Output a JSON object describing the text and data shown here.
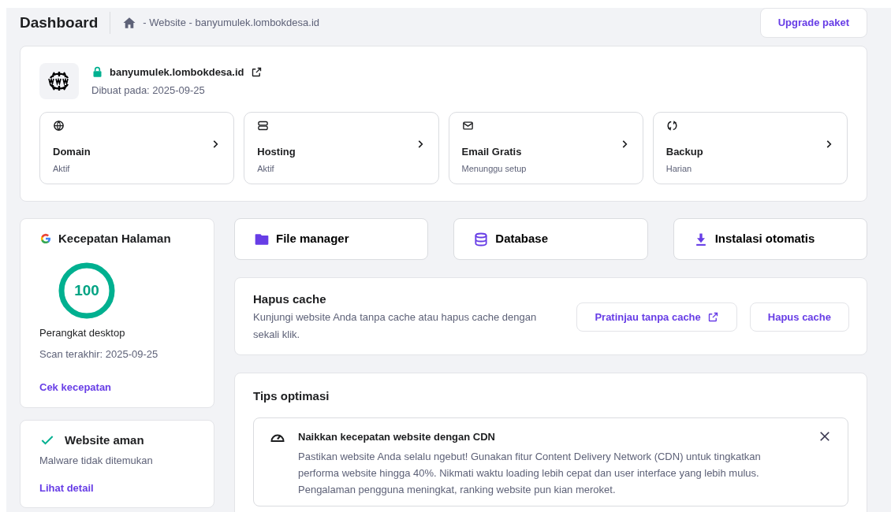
{
  "header": {
    "title": "Dashboard",
    "breadcrumb": "- Website - banyumulek.lombokdesa.id",
    "upgrade_button": "Upgrade paket"
  },
  "site": {
    "domain": "banyumulek.lombokdesa.id",
    "secure": true,
    "created": "Dibuat pada: 2025-09-25",
    "services": [
      {
        "kind": "globe",
        "title": "Domain",
        "status": "Aktif"
      },
      {
        "kind": "server",
        "title": "Hosting",
        "status": "Aktif"
      },
      {
        "kind": "mail",
        "title": "Email Gratis",
        "status": "Menunggu setup"
      },
      {
        "kind": "sync",
        "title": "Backup",
        "status": "Harian"
      }
    ]
  },
  "speed": {
    "title": "Kecepatan Halaman",
    "score": "100",
    "level": 1,
    "device": "Perangkat desktop",
    "scan": "Scan terakhir: 2025-09-25",
    "link": "Cek kecepatan"
  },
  "security": {
    "title": "Website aman",
    "subtitle": "Malware tidak ditemukan",
    "link": "Lihat detail"
  },
  "shortcuts": [
    {
      "kind": "folder",
      "label": "File manager"
    },
    {
      "kind": "database",
      "label": "Database"
    },
    {
      "kind": "download",
      "label": "Instalasi otomatis"
    }
  ],
  "cache": {
    "title": "Hapus cache",
    "description": "Kunjungi website Anda tanpa cache atau hapus cache dengan sekali klik.",
    "preview_button": "Pratinjau tanpa cache",
    "clear_button": "Hapus cache"
  },
  "tips": {
    "title": "Tips optimasi",
    "items": [
      {
        "title": "Naikkan kecepatan website dengan CDN",
        "text": "Pastikan website Anda selalu ngebut! Gunakan fitur Content Delivery Network (CDN) untuk tingkatkan performa website hingga 40%. Nikmati waktu loading lebih cepat dan user interface yang lebih mulus. Pengalaman pengguna meningkat, ranking website pun kian meroket."
      }
    ]
  }
}
